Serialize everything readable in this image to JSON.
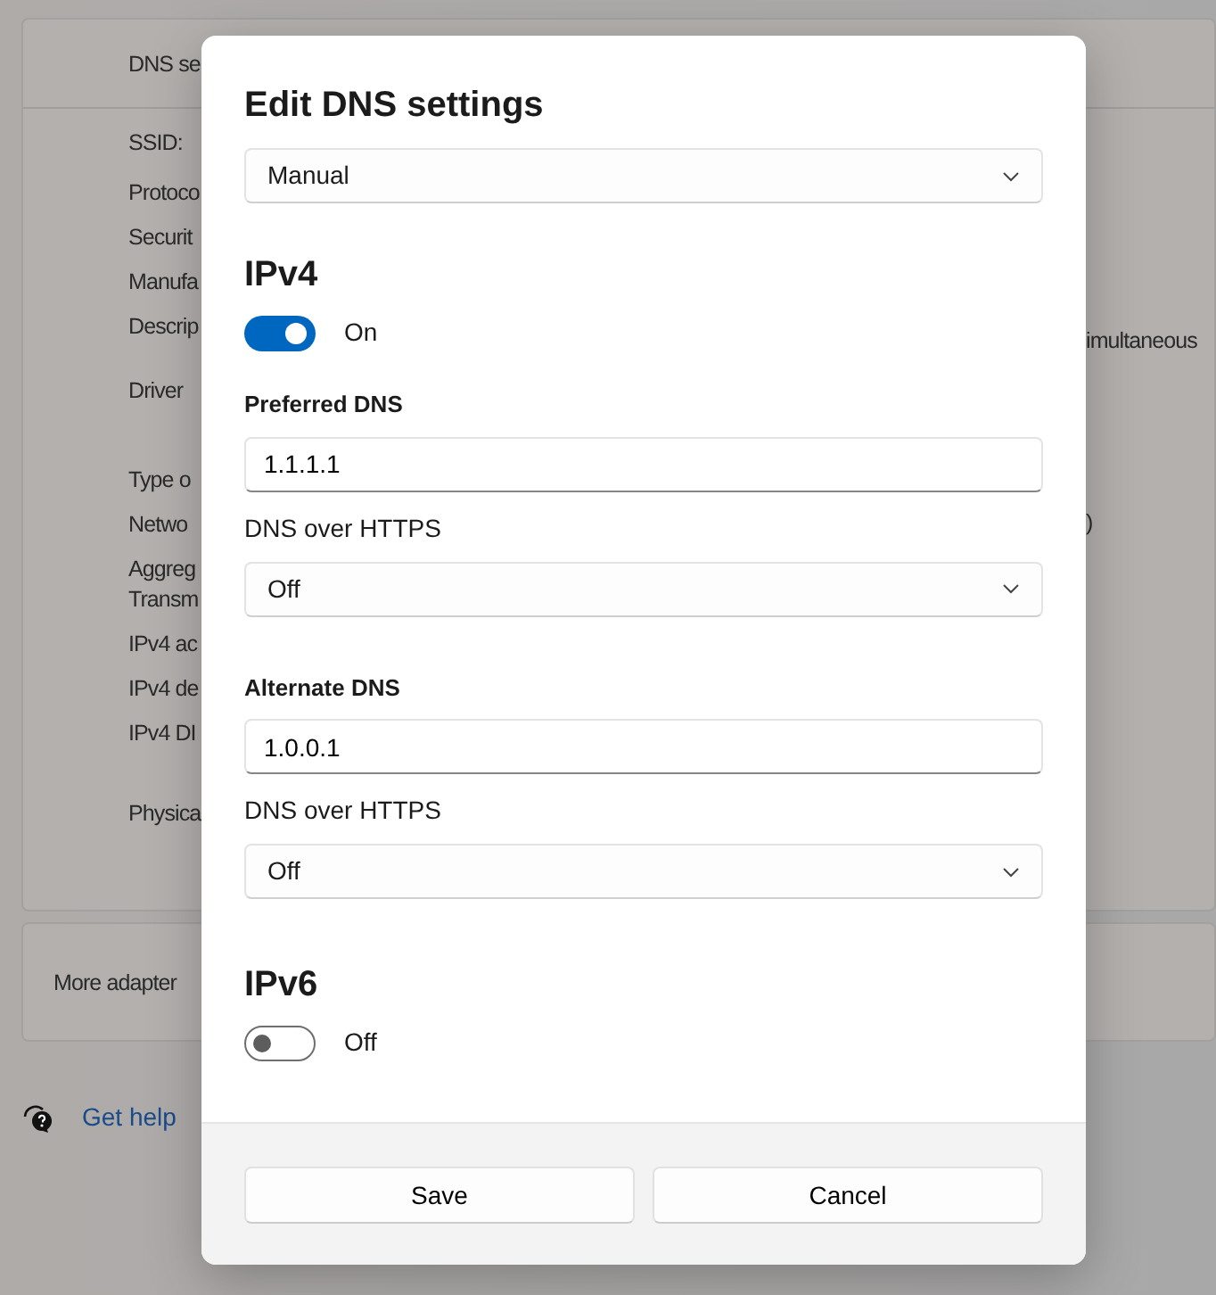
{
  "background": {
    "header_label": "DNS se",
    "row_labels": [
      "SSID:",
      "Protoco",
      "Securit",
      "Manufa",
      "Descrip",
      "Driver",
      "Type o",
      "Netwo",
      "Aggreg\nTransm",
      "IPv4 ac",
      "IPv4 de",
      "IPv4 DI",
      "Physica"
    ],
    "right_values": [
      "imultaneous",
      ")"
    ],
    "more_adapter": "More adapter",
    "help_link": "Get help"
  },
  "dialog": {
    "title": "Edit DNS settings",
    "mode": "Manual",
    "sections": [
      {
        "heading": "IPv4",
        "toggle": {
          "on": true,
          "label": "On"
        },
        "servers": [
          {
            "label": "Preferred DNS",
            "value": "1.1.1.1",
            "doh_label": "DNS over HTTPS",
            "doh_value": "Off"
          },
          {
            "label": "Alternate DNS",
            "value": "1.0.0.1",
            "doh_label": "DNS over HTTPS",
            "doh_value": "Off"
          }
        ]
      },
      {
        "heading": "IPv6",
        "toggle": {
          "on": false,
          "label": "Off"
        }
      }
    ],
    "buttons": [
      "Save",
      "Cancel"
    ]
  }
}
